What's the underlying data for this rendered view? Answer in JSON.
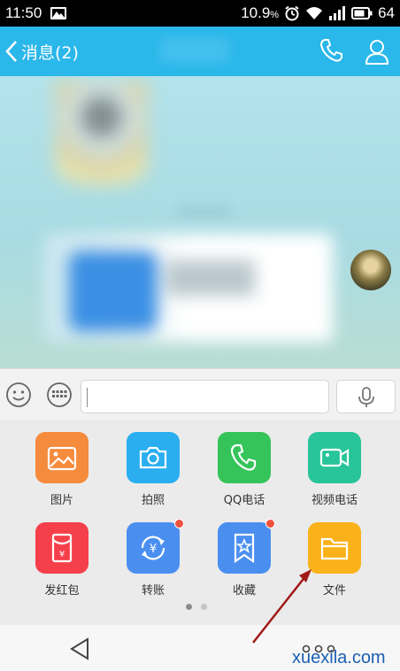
{
  "status_bar": {
    "time": "11:50",
    "data_speed": "10.9",
    "data_unit": "%",
    "battery": "64"
  },
  "header": {
    "back_label": "消息(2)"
  },
  "input": {
    "value": "",
    "placeholder": ""
  },
  "apps": [
    {
      "label": "图片",
      "color": "#f58b3c",
      "icon": "image-icon",
      "badge": false
    },
    {
      "label": "拍照",
      "color": "#2aaef0",
      "icon": "camera-icon",
      "badge": false
    },
    {
      "label": "QQ电话",
      "color": "#35c45a",
      "icon": "phone-icon",
      "badge": false
    },
    {
      "label": "视频电话",
      "color": "#28c49a",
      "icon": "video-icon",
      "badge": false
    },
    {
      "label": "发红包",
      "color": "#f5404b",
      "icon": "red-packet-icon",
      "badge": false
    },
    {
      "label": "转账",
      "color": "#4a8ff0",
      "icon": "transfer-icon",
      "badge": true
    },
    {
      "label": "收藏",
      "color": "#4a8ff0",
      "icon": "favorites-icon",
      "badge": true
    },
    {
      "label": "文件",
      "color": "#fab21a",
      "icon": "folder-icon",
      "badge": false
    }
  ],
  "pager": {
    "pages": 2,
    "current": 1
  },
  "watermark": "xuexila.com"
}
